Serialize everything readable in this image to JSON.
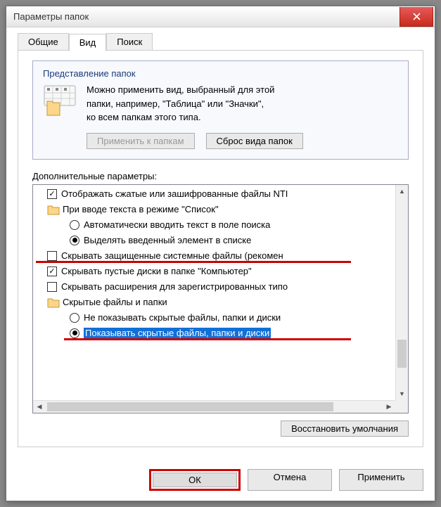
{
  "title": "Параметры папок",
  "tabs": {
    "general": "Общие",
    "view": "Вид",
    "search": "Поиск"
  },
  "groupbox": {
    "title": "Представление папок",
    "desc1": "Можно применить вид, выбранный для этой",
    "desc2": "папки, например, \"Таблица\" или \"Значки\",",
    "desc3": "ко всем папкам этого типа.",
    "btn_apply": "Применить к папкам",
    "btn_reset": "Сброс вида папок"
  },
  "section_label": "Дополнительные параметры:",
  "tree": [
    {
      "kind": "cb",
      "checked": true,
      "text": "Отображать сжатые или зашифрованные файлы NTI"
    },
    {
      "kind": "folder",
      "text": "При вводе текста в режиме \"Список\""
    },
    {
      "kind": "rb",
      "checked": false,
      "text": "Автоматически вводить текст в поле поиска"
    },
    {
      "kind": "rb",
      "checked": true,
      "text": "Выделять введенный элемент в списке"
    },
    {
      "kind": "cb",
      "checked": false,
      "text": "Скрывать защищенные системные файлы (рекомен"
    },
    {
      "kind": "cb",
      "checked": true,
      "text": "Скрывать пустые диски в папке \"Компьютер\""
    },
    {
      "kind": "cb",
      "checked": false,
      "text": "Скрывать расширения для зарегистрированных типо"
    },
    {
      "kind": "folder",
      "text": "Скрытые файлы и папки"
    },
    {
      "kind": "rb",
      "checked": false,
      "text": "Не показывать скрытые файлы, папки и диски"
    },
    {
      "kind": "rb",
      "checked": true,
      "selected": true,
      "text": "Показывать скрытые файлы, папки и диски"
    }
  ],
  "restore_btn": "Восстановить умолчания",
  "buttons": {
    "ok": "ОК",
    "cancel": "Отмена",
    "apply": "Применить"
  }
}
